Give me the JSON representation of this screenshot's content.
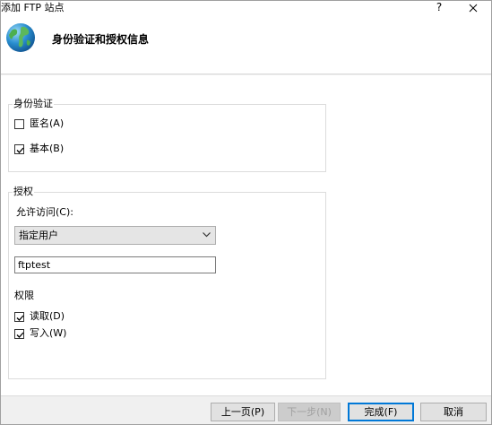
{
  "window": {
    "title": "添加 FTP 站点",
    "help": "?"
  },
  "header": {
    "title": "身份验证和授权信息",
    "icon": "globe-icon"
  },
  "authentication": {
    "group_label": "身份验证",
    "anonymous": {
      "label": "匿名(A)",
      "checked": false
    },
    "basic": {
      "label": "基本(B)",
      "checked": true
    }
  },
  "authorization": {
    "group_label": "授权",
    "allow_access_label": "允许访问(C):",
    "allow_access_value": "指定用户",
    "user_value": "ftptest",
    "permissions_label": "权限",
    "read": {
      "label": "读取(D)",
      "checked": true
    },
    "write": {
      "label": "写入(W)",
      "checked": true
    }
  },
  "footer": {
    "prev_label": "上一页(P)",
    "next_label": "下一步(N)",
    "finish_label": "完成(F)",
    "cancel_label": "取消"
  }
}
